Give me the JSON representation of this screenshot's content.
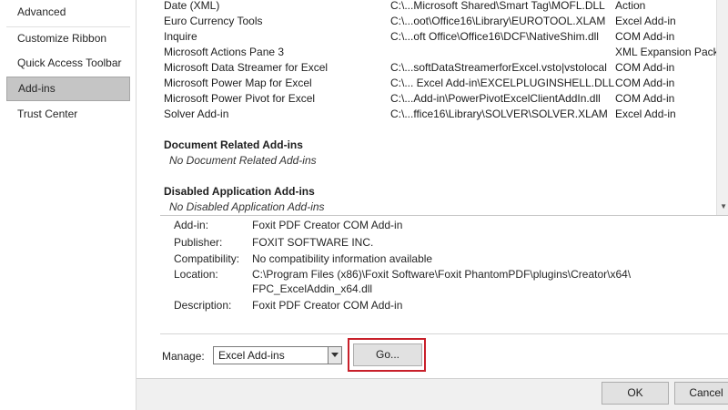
{
  "nav": {
    "items": [
      {
        "label": "Advanced"
      },
      {
        "label": "Customize Ribbon"
      },
      {
        "label": "Quick Access Toolbar"
      },
      {
        "label": "Add-ins",
        "selected": true
      },
      {
        "label": "Trust Center"
      }
    ]
  },
  "addins": {
    "active_rows": [
      {
        "name": "Date (XML)",
        "location": "C:\\...Microsoft Shared\\Smart Tag\\MOFL.DLL",
        "type": "Action"
      },
      {
        "name": "Euro Currency Tools",
        "location": "C:\\...oot\\Office16\\Library\\EUROTOOL.XLAM",
        "type": "Excel Add-in"
      },
      {
        "name": "Inquire",
        "location": "C:\\...oft Office\\Office16\\DCF\\NativeShim.dll",
        "type": "COM Add-in"
      },
      {
        "name": "Microsoft Actions Pane 3",
        "location": "",
        "type": "XML Expansion Pack"
      },
      {
        "name": "Microsoft Data Streamer for Excel",
        "location": "C:\\...softDataStreamerforExcel.vsto|vstolocal",
        "type": "COM Add-in"
      },
      {
        "name": "Microsoft Power Map for Excel",
        "location": "C:\\... Excel Add-in\\EXCELPLUGINSHELL.DLL",
        "type": "COM Add-in"
      },
      {
        "name": "Microsoft Power Pivot for Excel",
        "location": "C:\\...Add-in\\PowerPivotExcelClientAddIn.dll",
        "type": "COM Add-in"
      },
      {
        "name": "Solver Add-in",
        "location": "C:\\...ffice16\\Library\\SOLVER\\SOLVER.XLAM",
        "type": "Excel Add-in"
      }
    ],
    "groups": [
      {
        "header": "Document Related Add-ins",
        "empty": "No Document Related Add-ins"
      },
      {
        "header": "Disabled Application Add-ins",
        "empty": "No Disabled Application Add-ins"
      }
    ]
  },
  "details": {
    "addin_label": "Add-in:",
    "addin_value": "Foxit PDF Creator COM Add-in",
    "publisher_label": "Publisher:",
    "publisher_value": "FOXIT SOFTWARE INC.",
    "compat_label": "Compatibility:",
    "compat_value": "No compatibility information available",
    "location_label": "Location:",
    "location_value_1": "C:\\Program Files (x86)\\Foxit Software\\Foxit PhantomPDF\\plugins\\Creator\\x64\\",
    "location_value_2": "FPC_ExcelAddin_x64.dll",
    "description_label": "Description:",
    "description_value": "Foxit PDF Creator COM Add-in"
  },
  "manage": {
    "label": "Manage:",
    "selected": "Excel Add-ins",
    "go_label": "Go..."
  },
  "footer": {
    "ok_label": "OK",
    "cancel_label": "Cancel"
  },
  "colors": {
    "highlight": "#c8202a",
    "selected_nav": "#c5c5c5"
  }
}
